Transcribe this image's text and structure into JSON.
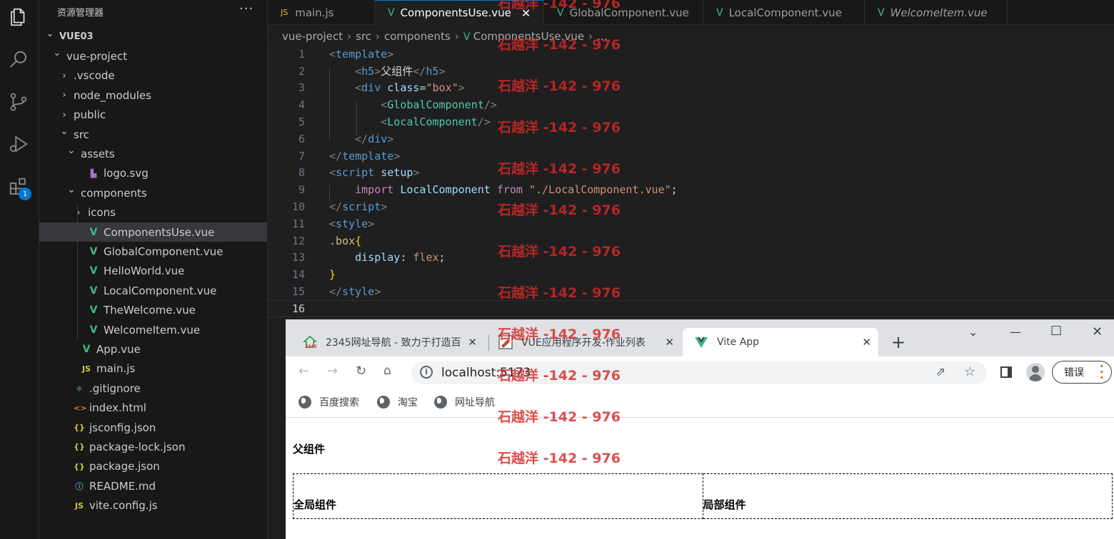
{
  "explorer": {
    "title": "资源管理器",
    "more": "···",
    "tree": [
      {
        "label": "VUE03",
        "type": "root",
        "chevron": "⌄"
      },
      {
        "label": "vue-project",
        "type": "folder",
        "chevron": "⌄"
      },
      {
        "label": ".vscode",
        "type": "folder",
        "chevron": "›"
      },
      {
        "label": "node_modules",
        "type": "folder",
        "chevron": "›"
      },
      {
        "label": "public",
        "type": "folder",
        "chevron": "›"
      },
      {
        "label": "src",
        "type": "folder",
        "chevron": "⌄"
      },
      {
        "label": "assets",
        "type": "folder",
        "chevron": "⌄"
      },
      {
        "label": "logo.svg",
        "type": "svg"
      },
      {
        "label": "components",
        "type": "folder",
        "chevron": "⌄"
      },
      {
        "label": "icons",
        "type": "folder",
        "chevron": "›"
      },
      {
        "label": "ComponentsUse.vue",
        "type": "vue",
        "selected": true
      },
      {
        "label": "GlobalComponent.vue",
        "type": "vue"
      },
      {
        "label": "HelloWorld.vue",
        "type": "vue"
      },
      {
        "label": "LocalComponent.vue",
        "type": "vue"
      },
      {
        "label": "TheWelcome.vue",
        "type": "vue"
      },
      {
        "label": "WelcomeItem.vue",
        "type": "vue"
      },
      {
        "label": "App.vue",
        "type": "vue"
      },
      {
        "label": "main.js",
        "type": "js"
      },
      {
        "label": ".gitignore",
        "type": "git"
      },
      {
        "label": "index.html",
        "type": "html"
      },
      {
        "label": "jsconfig.json",
        "type": "json"
      },
      {
        "label": "package-lock.json",
        "type": "json"
      },
      {
        "label": "package.json",
        "type": "json"
      },
      {
        "label": "README.md",
        "type": "md"
      },
      {
        "label": "vite.config.js",
        "type": "js"
      }
    ]
  },
  "activity": {
    "extensions_badge": "1"
  },
  "editor": {
    "tabs": [
      {
        "label": "main.js",
        "type": "js"
      },
      {
        "label": "ComponentsUse.vue",
        "type": "vue",
        "active": true,
        "close": "✕"
      },
      {
        "label": "GlobalComponent.vue",
        "type": "vue"
      },
      {
        "label": "LocalComponent.vue",
        "type": "vue"
      },
      {
        "label": "WelcomeItem.vue",
        "type": "vue"
      }
    ],
    "breadcrumb": [
      "vue-project",
      "src",
      "components",
      "ComponentsUse.vue",
      "..."
    ],
    "current_line": 16,
    "lines": [
      {
        "n": "1",
        "tokens": [
          [
            "punct",
            "<"
          ],
          [
            "tag",
            "template"
          ],
          [
            "punct",
            ">"
          ]
        ]
      },
      {
        "n": "2",
        "tokens": [
          [
            "plain",
            "    "
          ],
          [
            "punct",
            "<"
          ],
          [
            "tag",
            "h5"
          ],
          [
            "punct",
            ">"
          ],
          [
            "plain",
            "父组件"
          ],
          [
            "punct",
            "</"
          ],
          [
            "tag",
            "h5"
          ],
          [
            "punct",
            ">"
          ]
        ]
      },
      {
        "n": "3",
        "tokens": [
          [
            "plain",
            "    "
          ],
          [
            "punct",
            "<"
          ],
          [
            "tag",
            "div"
          ],
          [
            "plain",
            " "
          ],
          [
            "attr",
            "class"
          ],
          [
            "plain",
            "="
          ],
          [
            "str",
            "\"box\""
          ],
          [
            "punct",
            ">"
          ]
        ]
      },
      {
        "n": "4",
        "tokens": [
          [
            "plain",
            "        "
          ],
          [
            "punct",
            "<"
          ],
          [
            "comp",
            "GlobalComponent"
          ],
          [
            "punct",
            "/>"
          ]
        ]
      },
      {
        "n": "5",
        "tokens": [
          [
            "plain",
            "        "
          ],
          [
            "punct",
            "<"
          ],
          [
            "comp",
            "LocalComponent"
          ],
          [
            "punct",
            "/>"
          ]
        ]
      },
      {
        "n": "6",
        "tokens": [
          [
            "plain",
            "    "
          ],
          [
            "punct",
            "</"
          ],
          [
            "tag",
            "div"
          ],
          [
            "punct",
            ">"
          ]
        ]
      },
      {
        "n": "7",
        "tokens": [
          [
            "punct",
            "</"
          ],
          [
            "tag",
            "template"
          ],
          [
            "punct",
            ">"
          ]
        ]
      },
      {
        "n": "8",
        "tokens": [
          [
            "punct",
            "<"
          ],
          [
            "tag",
            "script"
          ],
          [
            "plain",
            " "
          ],
          [
            "attr",
            "setup"
          ],
          [
            "punct",
            ">"
          ]
        ]
      },
      {
        "n": "9",
        "tokens": [
          [
            "plain",
            "    "
          ],
          [
            "kw",
            "import"
          ],
          [
            "plain",
            " "
          ],
          [
            "var",
            "LocalComponent"
          ],
          [
            "plain",
            " "
          ],
          [
            "kw",
            "from"
          ],
          [
            "plain",
            " "
          ],
          [
            "str",
            "\"./LocalComponent.vue\""
          ],
          [
            "plain",
            ";"
          ]
        ]
      },
      {
        "n": "10",
        "tokens": [
          [
            "punct",
            "</"
          ],
          [
            "tag",
            "script"
          ],
          [
            "punct",
            ">"
          ]
        ]
      },
      {
        "n": "11",
        "tokens": [
          [
            "punct",
            "<"
          ],
          [
            "tag",
            "style"
          ],
          [
            "punct",
            ">"
          ]
        ]
      },
      {
        "n": "12",
        "tokens": [
          [
            "sel",
            ".box"
          ],
          [
            "brace",
            "{"
          ]
        ]
      },
      {
        "n": "13",
        "tokens": [
          [
            "plain",
            "    "
          ],
          [
            "prop",
            "display"
          ],
          [
            "plain",
            ": "
          ],
          [
            "val",
            "flex"
          ],
          [
            "plain",
            ";"
          ]
        ]
      },
      {
        "n": "14",
        "tokens": [
          [
            "brace",
            "}"
          ]
        ]
      },
      {
        "n": "15",
        "tokens": [
          [
            "punct",
            "</"
          ],
          [
            "tag",
            "style"
          ],
          [
            "punct",
            ">"
          ]
        ]
      },
      {
        "n": "16",
        "tokens": []
      }
    ]
  },
  "browser": {
    "tabs": [
      {
        "label": "2345网址导航 - 致力于打造百",
        "close": "✕",
        "favicon": "2345-logo"
      },
      {
        "label": "VUE应用程序开发-作业列表",
        "close": "✕",
        "favicon": "homework-logo"
      },
      {
        "label": "Vite App",
        "close": "✕",
        "favicon": "vue-logo",
        "active": true
      }
    ],
    "new_tab": "+",
    "window_controls": {
      "dropdown": "⌄",
      "minimize": "—",
      "maximize": "☐",
      "close": "✕"
    },
    "url": "localhost:5173",
    "error_button": "错误",
    "bookmarks": [
      "百度搜索",
      "淘宝",
      "网址导航"
    ],
    "page": {
      "heading": "父组件",
      "global_component": "全局组件",
      "local_component": "局部组件"
    }
  },
  "watermark": {
    "text": "石越洋 -142 - 976",
    "color": "#d62828"
  }
}
